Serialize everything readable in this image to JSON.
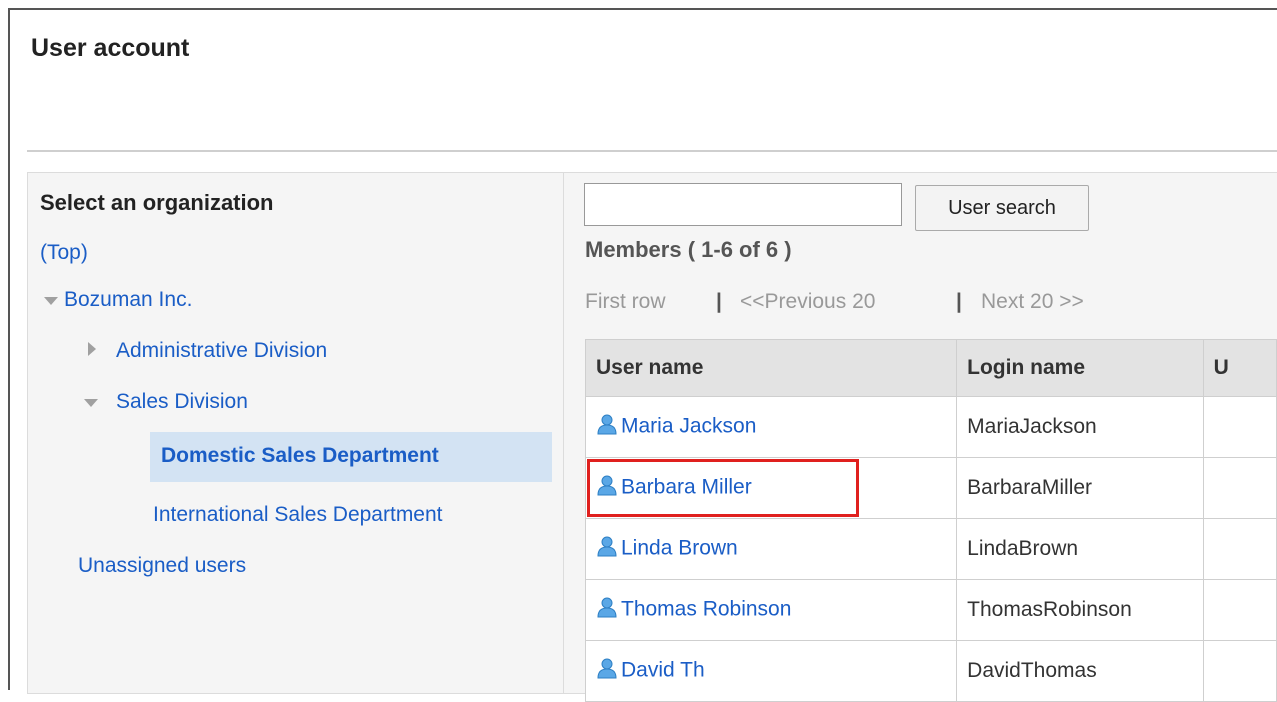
{
  "page": {
    "title": "User account"
  },
  "org_panel": {
    "heading": "Select an organization",
    "items": [
      {
        "label": "(Top)"
      },
      {
        "label": "Bozuman Inc."
      },
      {
        "label": "Administrative Division"
      },
      {
        "label": "Sales Division"
      },
      {
        "label": "Domestic Sales Department"
      },
      {
        "label": "International Sales Department"
      },
      {
        "label": "Unassigned users"
      }
    ]
  },
  "search": {
    "value": "",
    "placeholder": "",
    "button_label": "User search"
  },
  "members": {
    "title": "Members ( 1-6 of 6 )",
    "pager": {
      "first": "First row",
      "sep": "|",
      "prev": "<<Previous 20",
      "next": "Next 20 >>"
    },
    "columns": [
      "User name",
      "Login name",
      "U"
    ],
    "rows": [
      {
        "user": "Maria Jackson",
        "login": "MariaJackson"
      },
      {
        "user": "Barbara Miller",
        "login": "BarbaraMiller"
      },
      {
        "user": "Linda Brown",
        "login": "LindaBrown"
      },
      {
        "user": "Thomas Robinson",
        "login": "ThomasRobinson"
      },
      {
        "user": "David Th",
        "login": "DavidThomas"
      }
    ]
  },
  "icons": {
    "user": "person-icon",
    "expanded": "triangle-down-icon",
    "collapsed": "triangle-right-icon"
  },
  "colors": {
    "link": "#1a5dc6",
    "selected_bg": "#d3e3f3",
    "highlight": "#e0201e"
  }
}
